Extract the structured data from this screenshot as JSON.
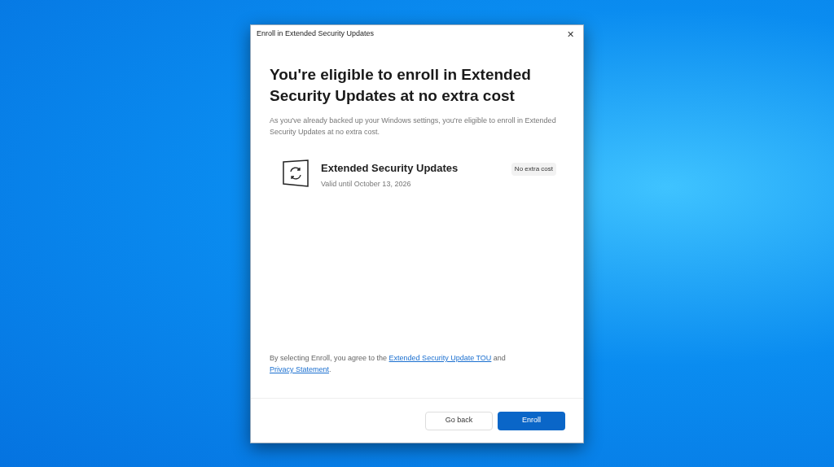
{
  "window": {
    "title": "Enroll in Extended Security Updates",
    "close": "✕"
  },
  "heading": "You're eligible to enroll in Extended Security Updates at no extra cost",
  "description": "As you've already backed up your Windows settings, you're eligible to enroll in Extended Security Updates at no extra cost.",
  "offer": {
    "title": "Extended Security Updates",
    "subtitle": "Valid until October 13, 2026",
    "badge": "No extra cost"
  },
  "agreement": {
    "before": "By selecting Enroll, you agree to the ",
    "link_1": "Extended Security Update TOU",
    "middle": " and ",
    "link_2": "Privacy Statement",
    "after": "."
  },
  "buttons": [
    {
      "label": "Go back",
      "kind": "secondary"
    },
    {
      "label": "Enroll",
      "kind": "primary"
    }
  ]
}
